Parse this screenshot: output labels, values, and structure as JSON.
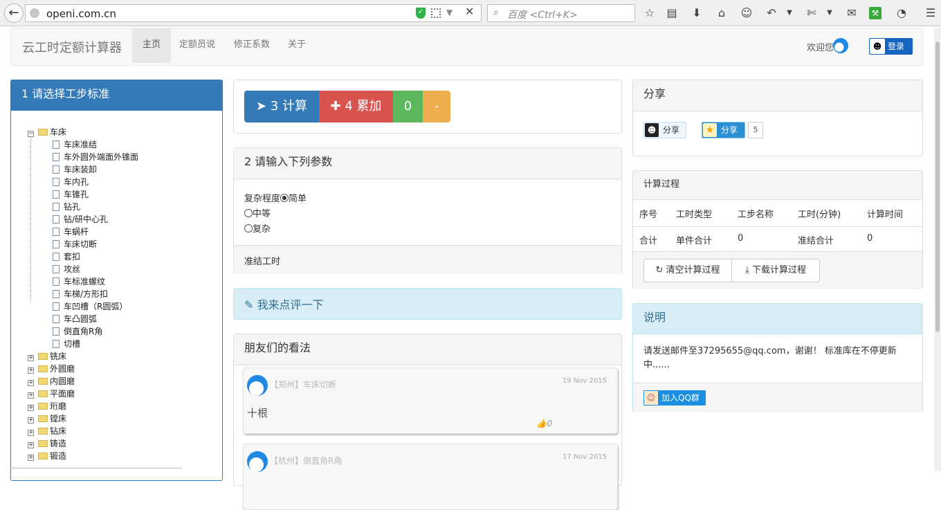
{
  "browser": {
    "url": "openi.com.cn",
    "search_placeholder": "百度 <Ctrl+K>"
  },
  "navbar": {
    "brand": "云工时定额计算器",
    "items": [
      {
        "label": "主页",
        "active": true
      },
      {
        "label": "定额员说"
      },
      {
        "label": "修正系数"
      },
      {
        "label": "关于"
      }
    ],
    "welcome": "欢迎您",
    "login": "登录"
  },
  "step1": {
    "title": "1 请选择工步标准",
    "tree": {
      "root": "车床",
      "children": [
        "车床准结",
        "车外圆外端面外锥面",
        "车床装卸",
        "车内孔",
        "车锥孔",
        "钻孔",
        "钻/研中心孔",
        "车蜗杆",
        "车床切断",
        "套扣",
        "攻丝",
        "车标准螺纹",
        "车梯/方形扣",
        "车凹槽（R圆弧）",
        "车凸圆弧",
        "倒直角R角",
        "切槽"
      ],
      "collapsed": [
        "铣床",
        "外圆磨",
        "内圆磨",
        "平面磨",
        "珩磨",
        "镗床",
        "钻床",
        "铸造",
        "锻造"
      ]
    }
  },
  "actions": {
    "calc": "3 计算",
    "accumulate": "4 累加",
    "count": "0",
    "minus": "-"
  },
  "step2": {
    "title": "2 请输入下列参数",
    "complexity_label": "复杂程度",
    "options": [
      "简单",
      "中等",
      "复杂"
    ],
    "selected": "简单",
    "footer": "准结工时"
  },
  "review": {
    "label": "我来点评一下"
  },
  "opinions": {
    "title": "朋友们的看法",
    "comments": [
      {
        "meta": "【郑州】车床切断",
        "date": "19 Nov 2015",
        "text": "十根",
        "likes": "0"
      },
      {
        "meta": "【杭州】倒直角R角",
        "date": "17 Nov 2015"
      }
    ]
  },
  "share": {
    "title": "分享",
    "qq_label": "分享",
    "star_label": "分享",
    "star_count": "5"
  },
  "process": {
    "title": "计算过程",
    "headers": [
      "序号",
      "工时类型",
      "工步名称",
      "工时(分钟)",
      "计算时间"
    ],
    "row": [
      "合计",
      "单件合计",
      "0",
      "准结合计",
      "0"
    ],
    "clear": "清空计算过程",
    "download": "下载计算过程"
  },
  "note": {
    "title": "说明",
    "text": "请发送邮件至37295655@qq.com，谢谢！ 标准库在不停更新中......",
    "join": "加入QQ群"
  }
}
